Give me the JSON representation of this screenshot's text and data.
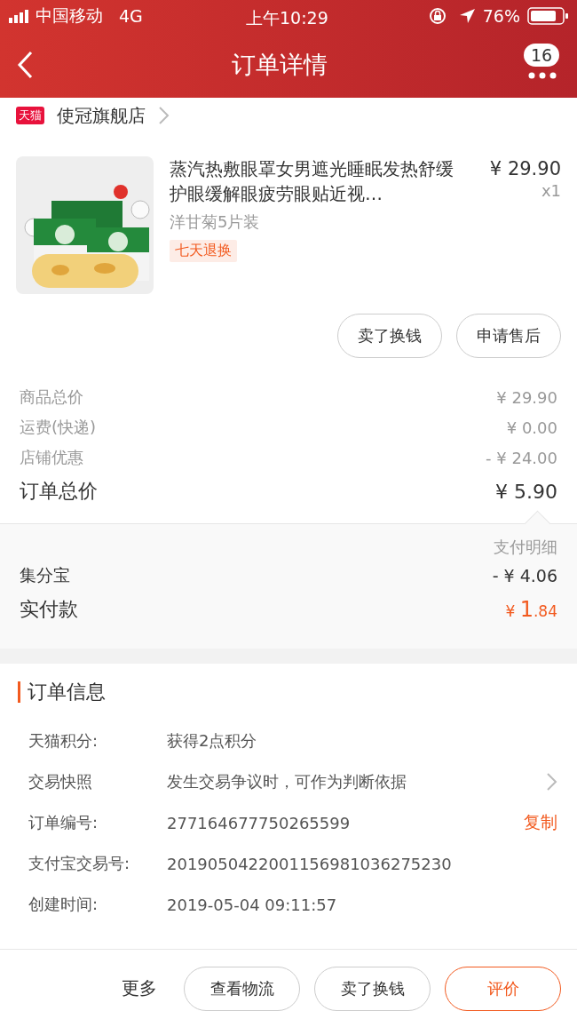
{
  "status_bar": {
    "carrier": "中国移动",
    "network": "4G",
    "time": "上午10:29",
    "battery": "76%"
  },
  "nav": {
    "title": "订单详情",
    "badge": "16"
  },
  "store": {
    "badge": "天猫",
    "name": "使冠旗舰店"
  },
  "product": {
    "kind": "picture",
    "title": "蒸汽热敷眼罩女男遮光睡眠发热舒缓护眼缓解眼疲劳眼贴近视…",
    "sku": "洋甘菊5片装",
    "tag": "七天退换",
    "price": "¥ 29.90",
    "quantity": "x1"
  },
  "item_actions": [
    "卖了换钱",
    "申请售后"
  ],
  "summary": [
    {
      "label": "商品总价",
      "value": "¥ 29.90",
      "kind": "line"
    },
    {
      "label": "运费(快递)",
      "value": "¥ 0.00",
      "kind": "line"
    },
    {
      "label": "店铺优惠",
      "value": "- ¥ 24.00",
      "kind": "line"
    },
    {
      "label": "订单总价",
      "value": "¥ 5.90",
      "kind": "total"
    }
  ],
  "payment": {
    "heading": "支付明细",
    "rows": [
      {
        "label": "集分宝",
        "value": "- ¥ 4.06",
        "kind": "line"
      },
      {
        "label": "实付款",
        "value": "¥ 1.84",
        "kind": "paid"
      }
    ]
  },
  "order_info": {
    "title": "订单信息",
    "rows": [
      {
        "label": "天猫积分:",
        "value": "获得2点积分",
        "kind": "text"
      },
      {
        "label": "交易快照",
        "value": "发生交易争议时，可作为判断依据",
        "kind": "link"
      },
      {
        "label": "订单编号:",
        "value": "277164677750265599",
        "kind": "copy",
        "action": "复制"
      },
      {
        "label": "支付宝交易号:",
        "value": "2019050422001156981036275230",
        "kind": "text"
      },
      {
        "label": "创建时间:",
        "value": "2019-05-04 09:11:57",
        "kind": "text"
      }
    ]
  },
  "bottom_bar": {
    "more": "更多",
    "buttons": [
      {
        "label": "查看物流",
        "kind": "plain"
      },
      {
        "label": "卖了换钱",
        "kind": "plain"
      },
      {
        "label": "评价",
        "kind": "primary"
      }
    ]
  }
}
